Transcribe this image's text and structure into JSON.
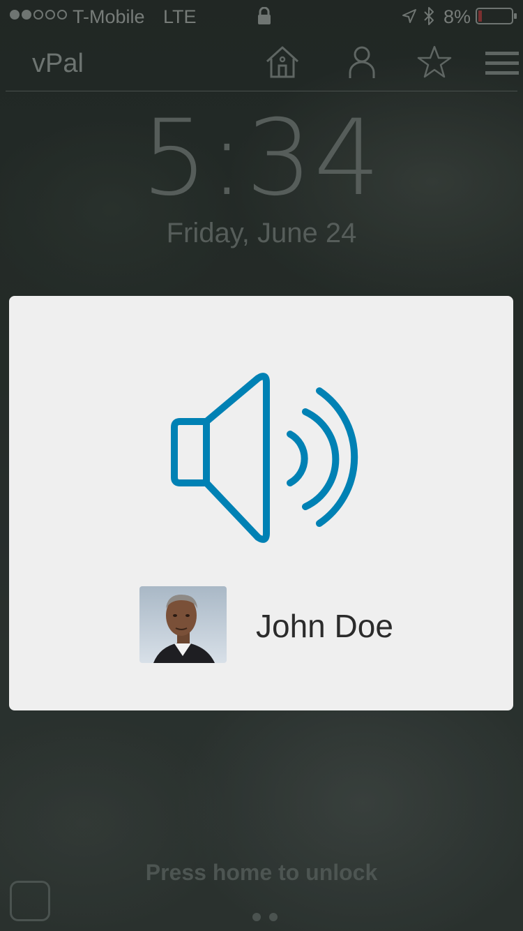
{
  "status_bar": {
    "signal_bars_filled": 2,
    "signal_bars_total": 5,
    "carrier": "T-Mobile",
    "network": "LTE",
    "battery_percent": "8%",
    "battery_level": 0.08,
    "icons": [
      "lock-icon",
      "location-icon",
      "bluetooth-icon",
      "battery-icon"
    ]
  },
  "app_header": {
    "title": "vPal",
    "icons": [
      "home-icon",
      "person-icon",
      "star-icon",
      "menu-icon"
    ]
  },
  "lock_screen": {
    "time": "5:34",
    "date": "Friday, June 24",
    "unlock_hint": "Press home to unlock"
  },
  "modal": {
    "icon": "speaker-volume-icon",
    "contact_name": "John Doe"
  },
  "colors": {
    "accent": "#0081b4",
    "modal_background": "#efefef",
    "name_text": "#2b2b2b"
  }
}
